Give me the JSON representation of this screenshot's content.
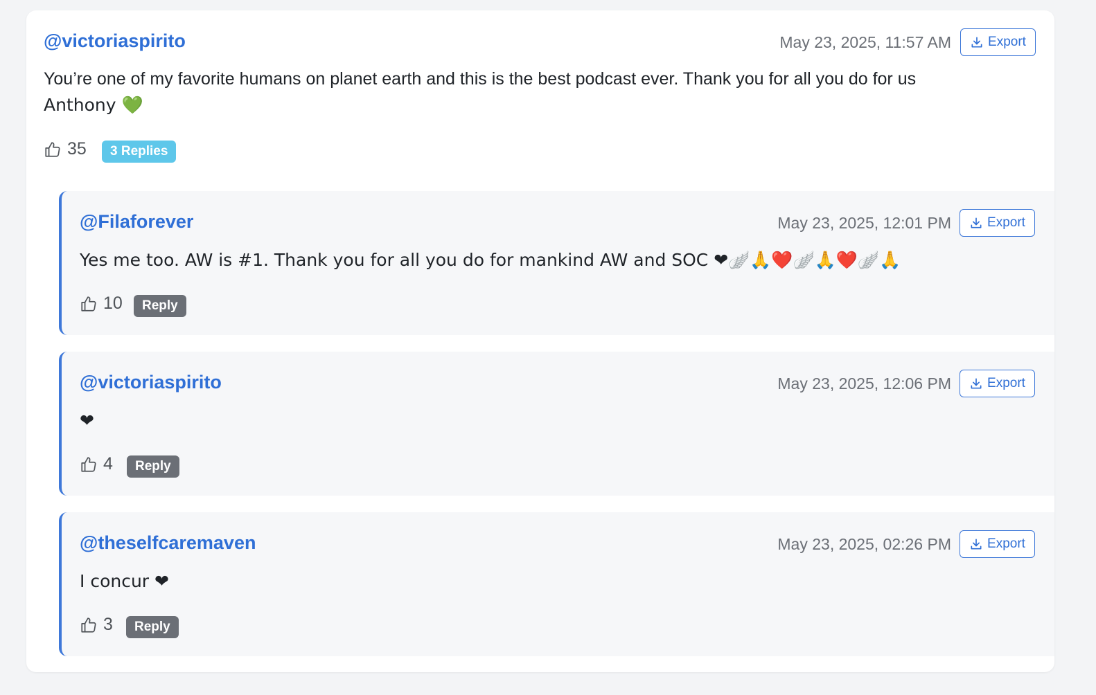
{
  "colors": {
    "accent": "#2f6fd6",
    "replies_badge": "#5ec7ea",
    "reply_badge": "#6b6f76",
    "reply_border": "#3e78d9"
  },
  "comment": {
    "author": "@victoriaspirito",
    "timestamp": "May 23, 2025, 11:57 AM",
    "export_label": "Export",
    "text_line1": "You’re one of my favorite humans on planet earth and this is the best podcast ever. Thank you for all you do for us",
    "text_line2": "Anthony 💚",
    "likes": "35",
    "replies_label": "3 Replies"
  },
  "replies": [
    {
      "author": "@Filaforever",
      "timestamp": "May 23, 2025, 12:01 PM",
      "export_label": "Export",
      "text": "Yes me too. AW is #1. Thank you for all you do for mankind AW and SOC ❤🪽🙏❤️🪽🙏❤️🪽🙏",
      "likes": "10",
      "reply_label": "Reply"
    },
    {
      "author": "@victoriaspirito",
      "timestamp": "May 23, 2025, 12:06 PM",
      "export_label": "Export",
      "text": "❤",
      "likes": "4",
      "reply_label": "Reply"
    },
    {
      "author": "@theselfcaremaven",
      "timestamp": "May 23, 2025, 02:26 PM",
      "export_label": "Export",
      "text": "I concur ❤",
      "likes": "3",
      "reply_label": "Reply"
    }
  ],
  "icons": {
    "export": "download-icon",
    "like": "thumbs-up-icon"
  }
}
